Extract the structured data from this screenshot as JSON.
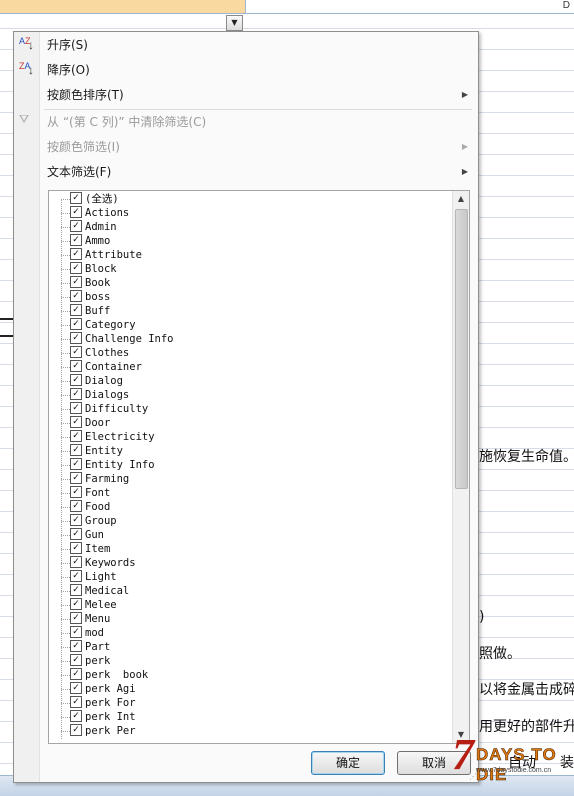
{
  "sheet": {
    "column_letter": "D",
    "cell_texts": [
      "施恢复生命值。",
      ")",
      "照做。",
      "以将金属击成碎",
      "用更好的部件升",
      "自动",
      "装"
    ]
  },
  "filter_menu": {
    "items": [
      {
        "label": "升序(S)",
        "icon": "sort-ascending-icon",
        "enabled": true
      },
      {
        "label": "降序(O)",
        "icon": "sort-descending-icon",
        "enabled": true
      },
      {
        "label": "按颜色排序(T)",
        "submenu": true,
        "enabled": true
      },
      {
        "label": "从 “(第 C 列)” 中清除筛选(C)",
        "icon": "clear-filter-icon",
        "enabled": false
      },
      {
        "label": "按颜色筛选(I)",
        "submenu": true,
        "enabled": false
      },
      {
        "label": "文本筛选(F)",
        "submenu": true,
        "enabled": true
      }
    ],
    "checklist": [
      {
        "label": "(全选)",
        "checked": true
      },
      {
        "label": "Actions",
        "checked": true
      },
      {
        "label": "Admin",
        "checked": true
      },
      {
        "label": "Ammo",
        "checked": true
      },
      {
        "label": "Attribute",
        "checked": true
      },
      {
        "label": "Block",
        "checked": true
      },
      {
        "label": "Book",
        "checked": true
      },
      {
        "label": "boss",
        "checked": true
      },
      {
        "label": "Buff",
        "checked": true
      },
      {
        "label": "Category",
        "checked": true
      },
      {
        "label": "Challenge Info",
        "checked": true
      },
      {
        "label": "Clothes",
        "checked": true
      },
      {
        "label": "Container",
        "checked": true
      },
      {
        "label": "Dialog",
        "checked": true
      },
      {
        "label": "Dialogs",
        "checked": true
      },
      {
        "label": "Difficulty",
        "checked": true
      },
      {
        "label": "Door",
        "checked": true
      },
      {
        "label": "Electricity",
        "checked": true
      },
      {
        "label": "Entity",
        "checked": true
      },
      {
        "label": "Entity Info",
        "checked": true
      },
      {
        "label": "Farming",
        "checked": true
      },
      {
        "label": "Font",
        "checked": true
      },
      {
        "label": "Food",
        "checked": true
      },
      {
        "label": "Group",
        "checked": true
      },
      {
        "label": "Gun",
        "checked": true
      },
      {
        "label": "Item",
        "checked": true
      },
      {
        "label": "Keywords",
        "checked": true
      },
      {
        "label": "Light",
        "checked": true
      },
      {
        "label": "Medical",
        "checked": true
      },
      {
        "label": "Melee",
        "checked": true
      },
      {
        "label": "Menu",
        "checked": true
      },
      {
        "label": "mod",
        "checked": true
      },
      {
        "label": "Part",
        "checked": true
      },
      {
        "label": "perk",
        "checked": true
      },
      {
        "label": "perk  book",
        "checked": true
      },
      {
        "label": "perk Agi",
        "checked": true
      },
      {
        "label": "perk For",
        "checked": true
      },
      {
        "label": "perk Int",
        "checked": true
      },
      {
        "label": "perk Per",
        "checked": true
      }
    ],
    "ok_label": "确定",
    "cancel_label": "取消"
  },
  "logo": {
    "numeral": "7",
    "wordmark": "DAYS TO DIE",
    "site": "www.7daystodie.com.cn"
  },
  "colors": {
    "selected_header": "#f9d99f",
    "menu_background": "#fafafa",
    "ok_border": "#3c7fb1"
  }
}
